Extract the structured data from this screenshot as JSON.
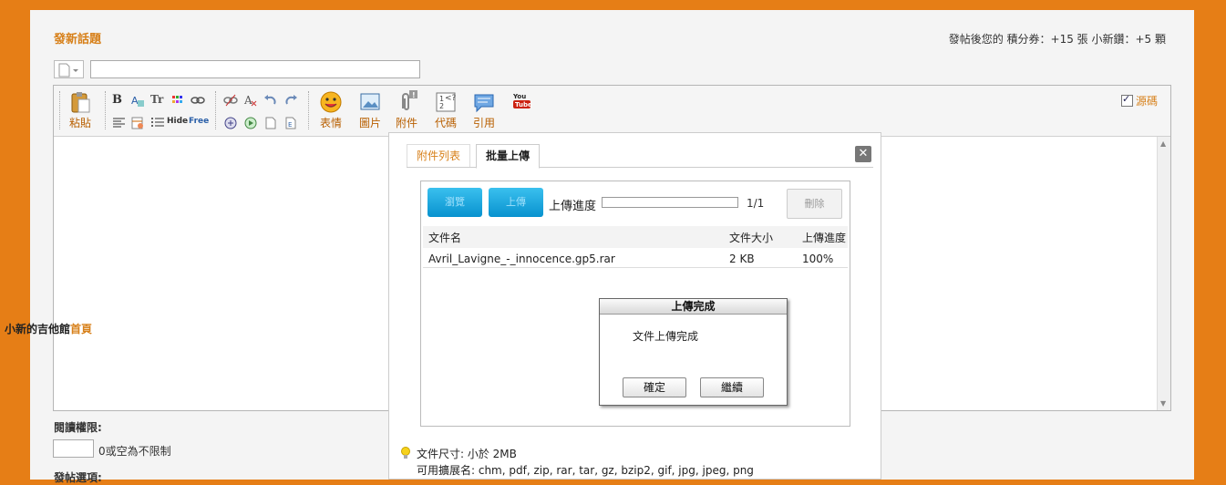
{
  "header": {
    "title": "發新話題",
    "reward_text": "發帖後您的 積分券：+15 張  小新鑽：+5 顆"
  },
  "toolbar": {
    "paste": "粘貼",
    "emoji": "表情",
    "image": "圖片",
    "attach": "附件",
    "code": "代碼",
    "quote": "引用",
    "hide": "Hide",
    "free": "Free",
    "source_label": "源碼"
  },
  "sidebar": {
    "site_name": "小新的吉他館",
    "home_link": "首頁"
  },
  "permission": {
    "label": "閱讀權限:",
    "hint": "0或空為不限制"
  },
  "post_options": {
    "label": "發帖選項:"
  },
  "upload_dialog": {
    "tabs": [
      "附件列表",
      "批量上傳"
    ],
    "active_tab": "批量上傳",
    "browse_label": "瀏覽",
    "upload_label": "上傳",
    "progress_label": "上傳進度",
    "progress_fraction": 1.0,
    "progress_count": "1/1",
    "delete_label": "刪除",
    "columns": [
      "文件名",
      "文件大小",
      "上傳進度"
    ],
    "files": [
      {
        "name": "Avril_Lavigne_-_innocence.gp5.rar",
        "size": "2 KB",
        "progress": "100%"
      }
    ],
    "alert": {
      "title": "上傳完成",
      "message": "文件上傳完成",
      "ok": "確定",
      "continue": "繼續"
    },
    "file_size_text": "文件尺寸: 小於 2MB",
    "allowed_ext_text": "可用擴展名: chm, pdf, zip, rar, tar, gz, bzip2, gif, jpg, jpeg, png"
  },
  "colors": {
    "background": "#e67e16",
    "accent": "#d7801a",
    "upload_button": "#1aa6df"
  }
}
